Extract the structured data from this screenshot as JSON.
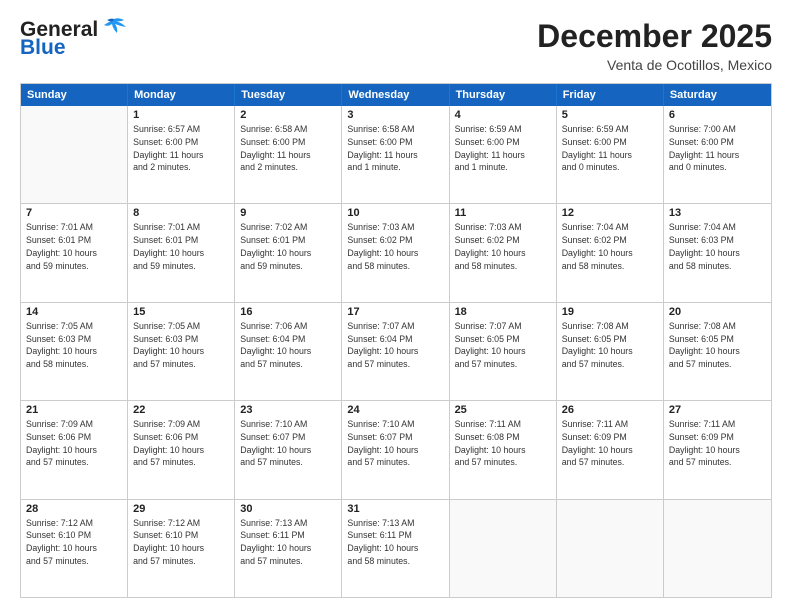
{
  "header": {
    "logo_general": "General",
    "logo_blue": "Blue",
    "month_title": "December 2025",
    "subtitle": "Venta de Ocotillos, Mexico"
  },
  "days_of_week": [
    "Sunday",
    "Monday",
    "Tuesday",
    "Wednesday",
    "Thursday",
    "Friday",
    "Saturday"
  ],
  "weeks": [
    [
      {
        "num": "",
        "empty": true,
        "info": ""
      },
      {
        "num": "1",
        "empty": false,
        "info": "Sunrise: 6:57 AM\nSunset: 6:00 PM\nDaylight: 11 hours\nand 2 minutes."
      },
      {
        "num": "2",
        "empty": false,
        "info": "Sunrise: 6:58 AM\nSunset: 6:00 PM\nDaylight: 11 hours\nand 2 minutes."
      },
      {
        "num": "3",
        "empty": false,
        "info": "Sunrise: 6:58 AM\nSunset: 6:00 PM\nDaylight: 11 hours\nand 1 minute."
      },
      {
        "num": "4",
        "empty": false,
        "info": "Sunrise: 6:59 AM\nSunset: 6:00 PM\nDaylight: 11 hours\nand 1 minute."
      },
      {
        "num": "5",
        "empty": false,
        "info": "Sunrise: 6:59 AM\nSunset: 6:00 PM\nDaylight: 11 hours\nand 0 minutes."
      },
      {
        "num": "6",
        "empty": false,
        "info": "Sunrise: 7:00 AM\nSunset: 6:00 PM\nDaylight: 11 hours\nand 0 minutes."
      }
    ],
    [
      {
        "num": "7",
        "empty": false,
        "info": "Sunrise: 7:01 AM\nSunset: 6:01 PM\nDaylight: 10 hours\nand 59 minutes."
      },
      {
        "num": "8",
        "empty": false,
        "info": "Sunrise: 7:01 AM\nSunset: 6:01 PM\nDaylight: 10 hours\nand 59 minutes."
      },
      {
        "num": "9",
        "empty": false,
        "info": "Sunrise: 7:02 AM\nSunset: 6:01 PM\nDaylight: 10 hours\nand 59 minutes."
      },
      {
        "num": "10",
        "empty": false,
        "info": "Sunrise: 7:03 AM\nSunset: 6:02 PM\nDaylight: 10 hours\nand 58 minutes."
      },
      {
        "num": "11",
        "empty": false,
        "info": "Sunrise: 7:03 AM\nSunset: 6:02 PM\nDaylight: 10 hours\nand 58 minutes."
      },
      {
        "num": "12",
        "empty": false,
        "info": "Sunrise: 7:04 AM\nSunset: 6:02 PM\nDaylight: 10 hours\nand 58 minutes."
      },
      {
        "num": "13",
        "empty": false,
        "info": "Sunrise: 7:04 AM\nSunset: 6:03 PM\nDaylight: 10 hours\nand 58 minutes."
      }
    ],
    [
      {
        "num": "14",
        "empty": false,
        "info": "Sunrise: 7:05 AM\nSunset: 6:03 PM\nDaylight: 10 hours\nand 58 minutes."
      },
      {
        "num": "15",
        "empty": false,
        "info": "Sunrise: 7:05 AM\nSunset: 6:03 PM\nDaylight: 10 hours\nand 57 minutes."
      },
      {
        "num": "16",
        "empty": false,
        "info": "Sunrise: 7:06 AM\nSunset: 6:04 PM\nDaylight: 10 hours\nand 57 minutes."
      },
      {
        "num": "17",
        "empty": false,
        "info": "Sunrise: 7:07 AM\nSunset: 6:04 PM\nDaylight: 10 hours\nand 57 minutes."
      },
      {
        "num": "18",
        "empty": false,
        "info": "Sunrise: 7:07 AM\nSunset: 6:05 PM\nDaylight: 10 hours\nand 57 minutes."
      },
      {
        "num": "19",
        "empty": false,
        "info": "Sunrise: 7:08 AM\nSunset: 6:05 PM\nDaylight: 10 hours\nand 57 minutes."
      },
      {
        "num": "20",
        "empty": false,
        "info": "Sunrise: 7:08 AM\nSunset: 6:05 PM\nDaylight: 10 hours\nand 57 minutes."
      }
    ],
    [
      {
        "num": "21",
        "empty": false,
        "info": "Sunrise: 7:09 AM\nSunset: 6:06 PM\nDaylight: 10 hours\nand 57 minutes."
      },
      {
        "num": "22",
        "empty": false,
        "info": "Sunrise: 7:09 AM\nSunset: 6:06 PM\nDaylight: 10 hours\nand 57 minutes."
      },
      {
        "num": "23",
        "empty": false,
        "info": "Sunrise: 7:10 AM\nSunset: 6:07 PM\nDaylight: 10 hours\nand 57 minutes."
      },
      {
        "num": "24",
        "empty": false,
        "info": "Sunrise: 7:10 AM\nSunset: 6:07 PM\nDaylight: 10 hours\nand 57 minutes."
      },
      {
        "num": "25",
        "empty": false,
        "info": "Sunrise: 7:11 AM\nSunset: 6:08 PM\nDaylight: 10 hours\nand 57 minutes."
      },
      {
        "num": "26",
        "empty": false,
        "info": "Sunrise: 7:11 AM\nSunset: 6:09 PM\nDaylight: 10 hours\nand 57 minutes."
      },
      {
        "num": "27",
        "empty": false,
        "info": "Sunrise: 7:11 AM\nSunset: 6:09 PM\nDaylight: 10 hours\nand 57 minutes."
      }
    ],
    [
      {
        "num": "28",
        "empty": false,
        "info": "Sunrise: 7:12 AM\nSunset: 6:10 PM\nDaylight: 10 hours\nand 57 minutes."
      },
      {
        "num": "29",
        "empty": false,
        "info": "Sunrise: 7:12 AM\nSunset: 6:10 PM\nDaylight: 10 hours\nand 57 minutes."
      },
      {
        "num": "30",
        "empty": false,
        "info": "Sunrise: 7:13 AM\nSunset: 6:11 PM\nDaylight: 10 hours\nand 57 minutes."
      },
      {
        "num": "31",
        "empty": false,
        "info": "Sunrise: 7:13 AM\nSunset: 6:11 PM\nDaylight: 10 hours\nand 58 minutes."
      },
      {
        "num": "",
        "empty": true,
        "info": ""
      },
      {
        "num": "",
        "empty": true,
        "info": ""
      },
      {
        "num": "",
        "empty": true,
        "info": ""
      }
    ]
  ]
}
